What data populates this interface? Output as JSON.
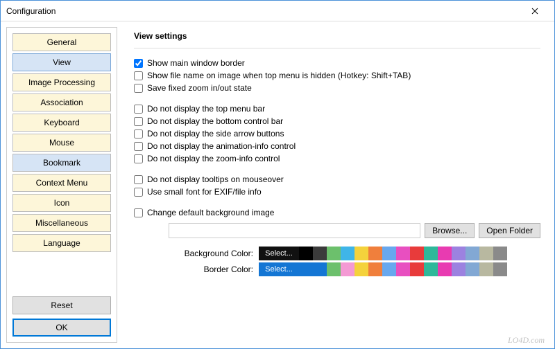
{
  "window": {
    "title": "Configuration"
  },
  "sidebar": {
    "categories": [
      {
        "label": "General",
        "selected": false
      },
      {
        "label": "View",
        "selected": true
      },
      {
        "label": "Image Processing",
        "selected": false
      },
      {
        "label": "Association",
        "selected": false
      },
      {
        "label": "Keyboard",
        "selected": false
      },
      {
        "label": "Mouse",
        "selected": false
      },
      {
        "label": "Bookmark",
        "selected": false,
        "hover": true
      },
      {
        "label": "Context Menu",
        "selected": false
      },
      {
        "label": "Icon",
        "selected": false
      },
      {
        "label": "Miscellaneous",
        "selected": false
      },
      {
        "label": "Language",
        "selected": false
      }
    ],
    "reset": "Reset",
    "ok": "OK"
  },
  "main": {
    "heading": "View settings",
    "group1": [
      {
        "label": "Show main window border",
        "checked": true
      },
      {
        "label": "Show file name on image when top menu is hidden (Hotkey: Shift+TAB)",
        "checked": false
      },
      {
        "label": "Save fixed zoom in/out state",
        "checked": false
      }
    ],
    "group2": [
      {
        "label": "Do not display the top menu bar",
        "checked": false
      },
      {
        "label": "Do not display the bottom control bar",
        "checked": false
      },
      {
        "label": "Do not display the side arrow buttons",
        "checked": false
      },
      {
        "label": "Do not display the animation-info control",
        "checked": false
      },
      {
        "label": "Do not display the zoom-info control",
        "checked": false
      }
    ],
    "group3": [
      {
        "label": "Do not display tooltips on mouseover",
        "checked": false
      },
      {
        "label": "Use small font for EXIF/file info",
        "checked": false
      }
    ],
    "group4": [
      {
        "label": "Change default background image",
        "checked": false
      }
    ],
    "browse": "Browse...",
    "open_folder": "Open Folder",
    "bg_color_label": "Background Color:",
    "border_color_label": "Border Color:",
    "select": "Select..."
  },
  "colors": {
    "bg_swatches": [
      "#000000",
      "#3b3b3b",
      "#6cc06c",
      "#3fb5e8",
      "#f4d23c",
      "#f07f3c",
      "#68a8ee",
      "#e84fc0",
      "#e83b3b",
      "#2fb89a",
      "#e83bb1",
      "#9c82e0",
      "#82a8d4",
      "#b8b8a0",
      "#8a8a8a"
    ],
    "border_swatches": [
      "#1476d4",
      "#1476d4",
      "#6cc06c",
      "#f49ad4",
      "#f4d23c",
      "#f07f3c",
      "#68a8ee",
      "#e84fc0",
      "#e83b3b",
      "#2fb89a",
      "#e83bb1",
      "#9c82e0",
      "#82a8d4",
      "#b8b8a0",
      "#8a8a8a"
    ]
  },
  "watermark": "LO4D.com"
}
